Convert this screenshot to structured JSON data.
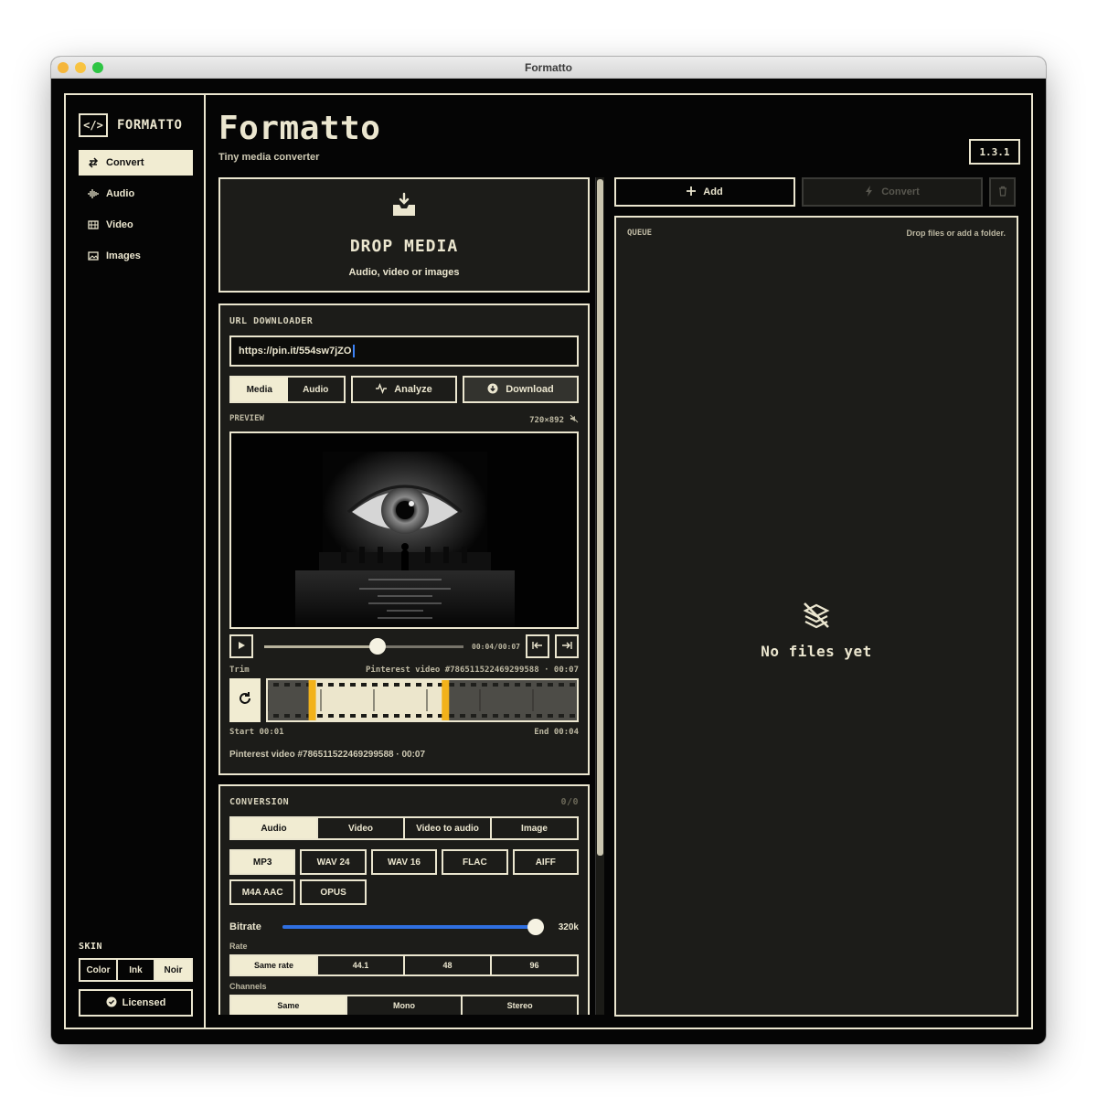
{
  "window": {
    "title": "Formatto",
    "traffic_lights": [
      "#f5b63b",
      "#f8c340",
      "#2ec544"
    ]
  },
  "sidebar": {
    "brand_icon": "</>",
    "brand": "FORMATTO",
    "nav": [
      {
        "label": "Convert",
        "icon": "swap-icon",
        "active": true
      },
      {
        "label": "Audio",
        "icon": "waveform-icon",
        "active": false
      },
      {
        "label": "Video",
        "icon": "film-icon",
        "active": false
      },
      {
        "label": "Images",
        "icon": "image-icon",
        "active": false
      }
    ],
    "skin_label": "SKIN",
    "skins": [
      "Color",
      "Ink",
      "Noir"
    ],
    "active_skin": "Noir",
    "licensed": "Licensed"
  },
  "header": {
    "title": "Formatto",
    "subtitle": "Tiny media converter",
    "version": "1.3.1"
  },
  "drop": {
    "title": "DROP MEDIA",
    "subtitle": "Audio, video or images"
  },
  "downloader": {
    "label": "URL DOWNLOADER",
    "url": "https://pin.it/554sw7jZO",
    "modes": [
      "Media",
      "Audio"
    ],
    "active_mode": "Media",
    "analyze": "Analyze",
    "download": "Download",
    "preview_label": "PREVIEW",
    "resolution": "720×892",
    "time": "00:04/00:07",
    "playback_progress": 0.57,
    "trim_label": "Trim",
    "trim_source": "Pinterest video #786511522469299588 · 00:07",
    "trim_start": "Start 00:01",
    "trim_end": "End 00:04",
    "trim_range": [
      1,
      4
    ],
    "duration": 7,
    "caption": "Pinterest video #786511522469299588 · 00:07"
  },
  "conversion": {
    "label": "CONVERSION",
    "count": "0/0",
    "tabs": [
      "Audio",
      "Video",
      "Video to audio",
      "Image"
    ],
    "active_tab": "Audio",
    "formats": [
      "MP3",
      "WAV 24",
      "WAV 16",
      "FLAC",
      "AIFF",
      "M4A AAC",
      "OPUS"
    ],
    "active_format": "MP3",
    "bitrate_label": "Bitrate",
    "bitrate_value": "320k",
    "bitrate_level": 1.0,
    "rate_label": "Rate",
    "rates": [
      "Same rate",
      "44.1",
      "48",
      "96"
    ],
    "active_rate": "Same rate",
    "channels_label": "Channels",
    "channels": [
      "Same",
      "Mono",
      "Stereo"
    ],
    "active_channel": "Same"
  },
  "queue": {
    "add": "Add",
    "convert": "Convert",
    "label": "QUEUE",
    "hint": "Drop files or add a folder.",
    "empty": "No files yet"
  },
  "colors": {
    "accent": "#f1ecd2",
    "background": "#050505",
    "panel": "#1c1c19",
    "slider_blue": "#2f6fe0",
    "trim_yellow": "#f2b21a"
  }
}
